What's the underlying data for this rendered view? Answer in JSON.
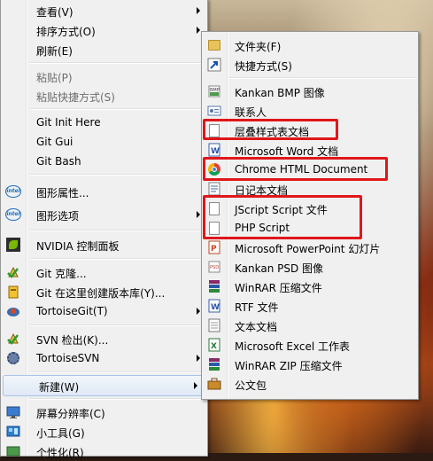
{
  "context_menu": {
    "items": [
      {
        "label": "查看(V)",
        "icon": "",
        "submenu": true
      },
      {
        "label": "排序方式(O)",
        "icon": "",
        "submenu": true
      },
      {
        "label": "刷新(E)",
        "icon": ""
      },
      {
        "label": "粘贴(P)",
        "icon": "",
        "disabled": true
      },
      {
        "label": "粘贴快捷方式(S)",
        "icon": "",
        "disabled": true
      },
      {
        "label": "Git Init Here",
        "icon": ""
      },
      {
        "label": "Git Gui",
        "icon": ""
      },
      {
        "label": "Git Bash",
        "icon": ""
      },
      {
        "label": "图形属性...",
        "icon": "intel-icon"
      },
      {
        "label": "图形选项",
        "icon": "intel-icon",
        "submenu": true
      },
      {
        "label": "NVIDIA 控制面板",
        "icon": "nvidia-icon"
      },
      {
        "label": "Git 克隆...",
        "icon": "git-clone-icon"
      },
      {
        "label": "Git 在这里创建版本库(Y)...",
        "icon": "git-create-repo-icon"
      },
      {
        "label": "TortoiseGit(T)",
        "icon": "tortoisegit-icon",
        "submenu": true
      },
      {
        "label": "SVN 检出(K)...",
        "icon": "svn-checkout-icon"
      },
      {
        "label": "TortoiseSVN",
        "icon": "tortoisesvn-icon",
        "submenu": true
      },
      {
        "label": "新建(W)",
        "icon": "",
        "submenu": true,
        "active": true
      },
      {
        "label": "屏幕分辨率(C)",
        "icon": "display-icon"
      },
      {
        "label": "小工具(G)",
        "icon": "gadgets-icon"
      },
      {
        "label": "个性化(R)",
        "icon": "personalize-icon"
      }
    ]
  },
  "new_submenu": {
    "items": [
      {
        "label": "文件夹(F)",
        "icon": "folder-icon"
      },
      {
        "label": "快捷方式(S)",
        "icon": "shortcut-icon"
      },
      {
        "label": "Kankan BMP 图像",
        "icon": "bmp-icon"
      },
      {
        "label": "联系人",
        "icon": "contact-icon"
      },
      {
        "label": "层叠样式表文档",
        "icon": "css-document-icon"
      },
      {
        "label": "Microsoft Word 文档",
        "icon": "word-icon"
      },
      {
        "label": "Chrome HTML Document",
        "icon": "chrome-icon"
      },
      {
        "label": "日记本文档",
        "icon": "journal-icon"
      },
      {
        "label": "JScript Script 文件",
        "icon": "jscript-icon"
      },
      {
        "label": "PHP Script",
        "icon": "php-script-icon"
      },
      {
        "label": "Microsoft PowerPoint 幻灯片",
        "icon": "powerpoint-icon"
      },
      {
        "label": "Kankan PSD 图像",
        "icon": "psd-icon"
      },
      {
        "label": "WinRAR 压缩文件",
        "icon": "winrar-icon"
      },
      {
        "label": "RTF 文件",
        "icon": "rtf-icon"
      },
      {
        "label": "文本文档",
        "icon": "text-document-icon"
      },
      {
        "label": "Microsoft Excel 工作表",
        "icon": "excel-icon"
      },
      {
        "label": "WinRAR ZIP 压缩文件",
        "icon": "winrar-zip-icon"
      },
      {
        "label": "公文包",
        "icon": "briefcase-icon"
      }
    ]
  },
  "colors": {
    "menu_bg": "#f0f0f0",
    "highlight_border": "#e0161b",
    "hover_border": "#a8c4e8"
  }
}
